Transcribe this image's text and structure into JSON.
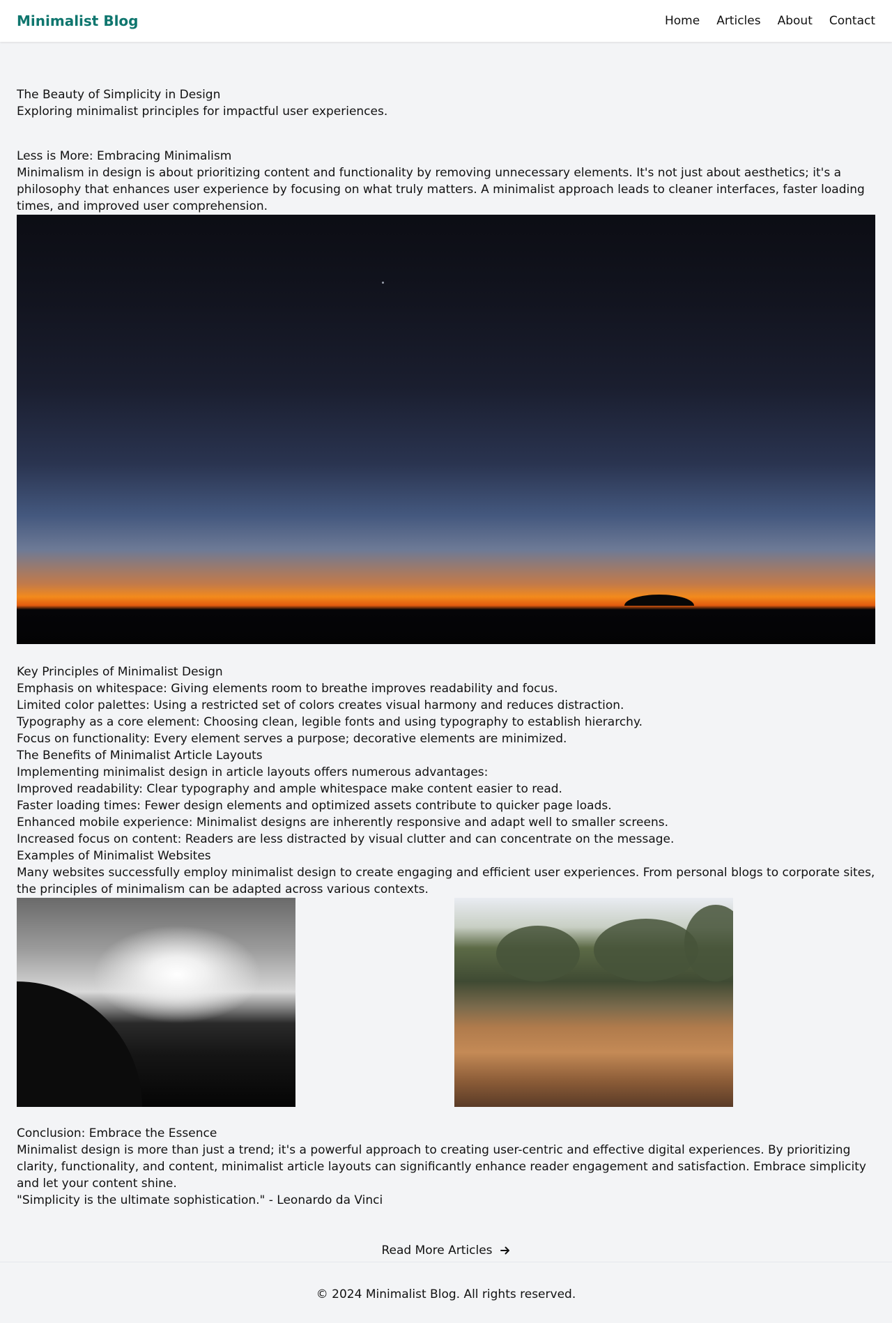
{
  "header": {
    "brand": "Minimalist Blog",
    "nav": [
      "Home",
      "Articles",
      "About",
      "Contact"
    ]
  },
  "hero": {
    "title": "The Beauty of Simplicity in Design",
    "subtitle": "Exploring minimalist principles for impactful user experiences."
  },
  "section1": {
    "heading": "Less is More: Embracing Minimalism",
    "body": "Minimalism in design is about prioritizing content and functionality by removing unnecessary elements. It's not just about aesthetics; it's a philosophy that enhances user experience by focusing on what truly matters. A minimalist approach leads to cleaner interfaces, faster loading times, and improved user comprehension."
  },
  "principles": {
    "heading": "Key Principles of Minimalist Design",
    "items": [
      "Emphasis on whitespace: Giving elements room to breathe improves readability and focus.",
      "Limited color palettes: Using a restricted set of colors creates visual harmony and reduces distraction.",
      "Typography as a core element: Choosing clean, legible fonts and using typography to establish hierarchy.",
      "Focus on functionality: Every element serves a purpose; decorative elements are minimized."
    ]
  },
  "benefits": {
    "heading": "The Benefits of Minimalist Article Layouts",
    "intro": "Implementing minimalist design in article layouts offers numerous advantages:",
    "items": [
      "Improved readability: Clear typography and ample whitespace make content easier to read.",
      "Faster loading times: Fewer design elements and optimized assets contribute to quicker page loads.",
      "Enhanced mobile experience: Minimalist designs are inherently responsive and adapt well to smaller screens.",
      "Increased focus on content: Readers are less distracted by visual clutter and can concentrate on the message."
    ]
  },
  "examples": {
    "heading": "Examples of Minimalist Websites",
    "body": "Many websites successfully employ minimalist design to create engaging and efficient user experiences. From personal blogs to corporate sites, the principles of minimalism can be adapted across various contexts."
  },
  "conclusion": {
    "heading": "Conclusion: Embrace the Essence",
    "body": "Minimalist design is more than just a trend; it's a powerful approach to creating user-centric and effective digital experiences. By prioritizing clarity, functionality, and content, minimalist article layouts can significantly enhance reader engagement and satisfaction. Embrace simplicity and let your content shine.",
    "quote": "\"Simplicity is the ultimate sophistication.\" - Leonardo da Vinci"
  },
  "cta": {
    "label": "Read More Articles",
    "icon": "arrow-right-icon"
  },
  "footer": {
    "copyright": "© 2024 Minimalist Blog. All rights reserved."
  },
  "colors": {
    "brand": "#0f766e",
    "background": "#f3f4f6",
    "header_bg": "#ffffff"
  }
}
